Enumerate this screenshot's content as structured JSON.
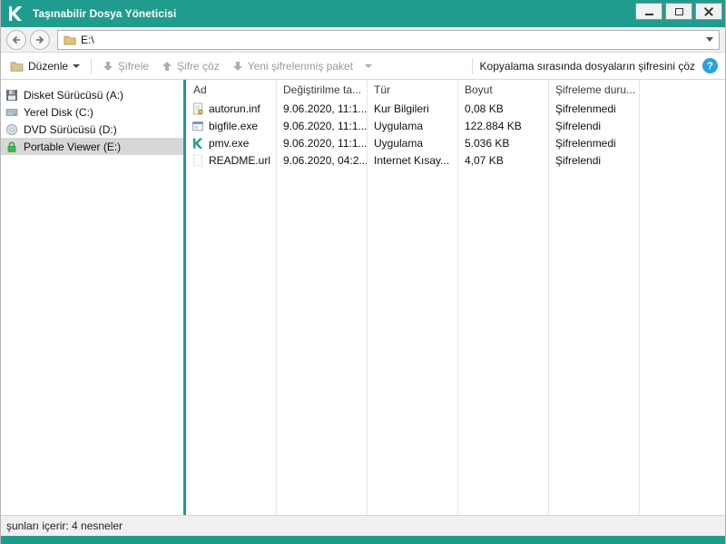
{
  "window": {
    "title": "Taşınabilir Dosya Yöneticisi"
  },
  "navbar": {
    "address": "E:\\"
  },
  "toolbar": {
    "organize_label": "Düzenle",
    "encrypt_label": "Şifrele",
    "decrypt_label": "Şifre çöz",
    "new_package_label": "Yeni şifrelenmiş paket",
    "copy_decrypt_label": "Kopyalama sırasında dosyaların şifresini çöz"
  },
  "sidebar": {
    "items": [
      {
        "label": "Disket Sürücüsü (A:)",
        "icon": "floppy-drive-icon"
      },
      {
        "label": "Yerel Disk (C:)",
        "icon": "hard-disk-icon"
      },
      {
        "label": "DVD Sürücüsü (D:)",
        "icon": "dvd-drive-icon"
      },
      {
        "label": "Portable Viewer (E:)",
        "icon": "lock-icon"
      }
    ]
  },
  "filelist": {
    "columns": [
      "Ad",
      "Değiştirilme ta...",
      "Tür",
      "Boyut",
      "Şifreleme duru..."
    ],
    "rows": [
      {
        "name": "autorun.inf",
        "modified": "9.06.2020, 11:1...",
        "type": "Kur Bilgileri",
        "size": "0,08 KB",
        "status": "Şifrelenmedi",
        "icon": "inf-file-icon"
      },
      {
        "name": "bigfile.exe",
        "modified": "9.06.2020, 11:1...",
        "type": "Uygulama",
        "size": "122.884 KB",
        "status": "Şifrelendi",
        "icon": "exe-file-icon"
      },
      {
        "name": "pmv.exe",
        "modified": "9.06.2020, 11:1...",
        "type": "Uygulama",
        "size": "5.036 KB",
        "status": "Şifrelenmedi",
        "icon": "kaspersky-k-icon"
      },
      {
        "name": "README.url",
        "modified": "9.06.2020, 04:2...",
        "type": "Internet Kısay...",
        "size": "4,07 KB",
        "status": "Şifrelendi",
        "icon": "url-file-icon"
      }
    ]
  },
  "statusbar": {
    "text": "şunları içerir: 4 nesneler"
  },
  "colors": {
    "accent_teal": "#1f9c8d",
    "info_blue": "#2aa2db",
    "selected_gray": "#d7d7d7"
  }
}
